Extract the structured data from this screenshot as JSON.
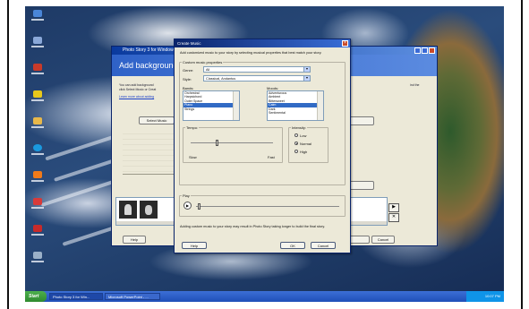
{
  "dialog": {
    "title": "Create Music",
    "intro": "Add customized music to your story by selecting musical properties that best match your story.",
    "properties_group": "Custom music properties",
    "genre_label": "Genre:",
    "genre_value": "All",
    "style_label": "Style:",
    "style_value": "Classical, Andantus",
    "bands_label": "Bands:",
    "bands": [
      "Orchestral",
      "Harpsichord",
      "Outer Space",
      "Piano",
      "Strings"
    ],
    "bands_selected": 3,
    "moods_label": "Moods:",
    "moods": [
      "Adventurous",
      "Ambient",
      "Bittersweet",
      "Calm",
      "Dark",
      "Sentimental"
    ],
    "moods_selected": 3,
    "tempo_label": "Tempo:",
    "tempo_slow": "Slow",
    "tempo_fast": "Fast",
    "intensity_label": "Intensity:",
    "intensity_options": [
      "Low",
      "Normal",
      "High"
    ],
    "intensity_selected": 1,
    "play_label": "Play",
    "note": "Adding custom music to your story may result in Photo Story taking longer to build the final story.",
    "help_button": "Help",
    "ok_button": "OK",
    "cancel_button": "Cancel"
  },
  "background_window": {
    "title": "Photo Story 3 for Windows",
    "heading": "Add background",
    "description_line1": "You can add background",
    "description_line2": "click Select Music or Creat",
    "link": "Learn more about adding",
    "select_music_button": "Select Music",
    "help_button": "Help",
    "cancel_button": "Cancel",
    "right_text": "ind the"
  },
  "taskbar": {
    "start_label": "Start",
    "tasks": [
      "Photo Story 3 for Win...",
      "Microsoft PowerPoint - ..."
    ],
    "clock": "10:07 PM"
  },
  "colors": {
    "titlebar": "#0a246a",
    "selection": "#316ac5",
    "window_face": "#ece9d8",
    "taskbar": "#245edb",
    "start_green": "#3c9a3c"
  }
}
